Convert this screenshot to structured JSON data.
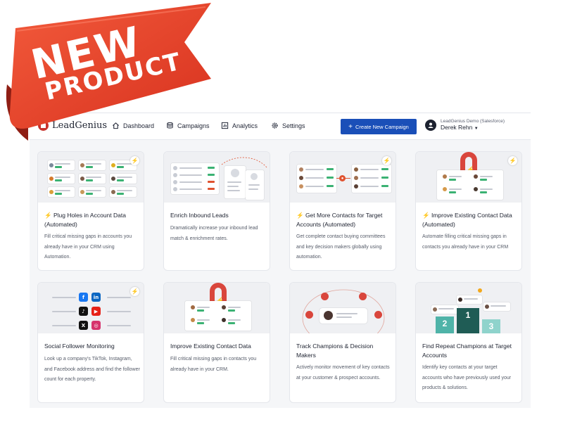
{
  "ribbon": {
    "line1": "NEW",
    "line2": "PRODUCT",
    "color": "#e8412c"
  },
  "brand": {
    "name": "LeadGenius",
    "color": "#c8332d"
  },
  "nav": [
    {
      "label": "Dashboard",
      "icon": "home-icon"
    },
    {
      "label": "Campaigns",
      "icon": "database-icon"
    },
    {
      "label": "Analytics",
      "icon": "chart-icon"
    },
    {
      "label": "Settings",
      "icon": "gear-icon"
    }
  ],
  "cta": {
    "label": "Create New Campaign",
    "icon": "plus-icon",
    "color": "#1a4fb8"
  },
  "user": {
    "org": "LeadGenius Demo (Salesforce)",
    "name": "Derek Rehn"
  },
  "cards": [
    {
      "title": "⚡ Plug Holes in Account Data (Automated)",
      "description": "Fill critical missing gaps in accounts you already have in your CRM using Automation."
    },
    {
      "title": "Enrich Inbound Leads",
      "description": "Dramatically increase your inbound lead match & enrichment rates."
    },
    {
      "title": "⚡ Get More Contacts for Target Accounts (Automated)",
      "description": "Get complete contact buying committees and key decision makers globally using automation."
    },
    {
      "title": "⚡ Improve Existing Contact Data (Automated)",
      "description": "Automate filling critical missing gaps in contacts you already have in your CRM"
    },
    {
      "title": "Social Follower Monitoring",
      "description": "Look up a company's TikTok, Instagram, and Facebook address and find the follower count for each property."
    },
    {
      "title": "Improve Existing Contact Data",
      "description": "Fill critical missing gaps in contacts you already have in your CRM."
    },
    {
      "title": "Track Champions & Decision Makers",
      "description": "Actively monitor movement of key contacts at your customer & prospect accounts."
    },
    {
      "title": "Find Repeat Champions at Target Accounts",
      "description": "Identify key contacts at your target accounts who have previously used your products & solutions."
    }
  ],
  "social_icons": [
    {
      "icon": "facebook-icon",
      "glyph": "f",
      "color": "#1877f2"
    },
    {
      "icon": "linkedin-icon",
      "glyph": "in",
      "color": "#0a66c2"
    },
    {
      "icon": "tiktok-icon",
      "glyph": "♪",
      "color": "#111111"
    },
    {
      "icon": "youtube-icon",
      "glyph": "▶",
      "color": "#e62117"
    },
    {
      "icon": "x-icon",
      "glyph": "X",
      "color": "#111111"
    },
    {
      "icon": "instagram-icon",
      "glyph": "◎",
      "color": "#d6336c"
    }
  ],
  "podium": {
    "first": "1",
    "second": "2",
    "third": "3",
    "color_first": "#1f5c55",
    "color_second": "#4fb3a8",
    "color_third": "#8fd3cc"
  }
}
